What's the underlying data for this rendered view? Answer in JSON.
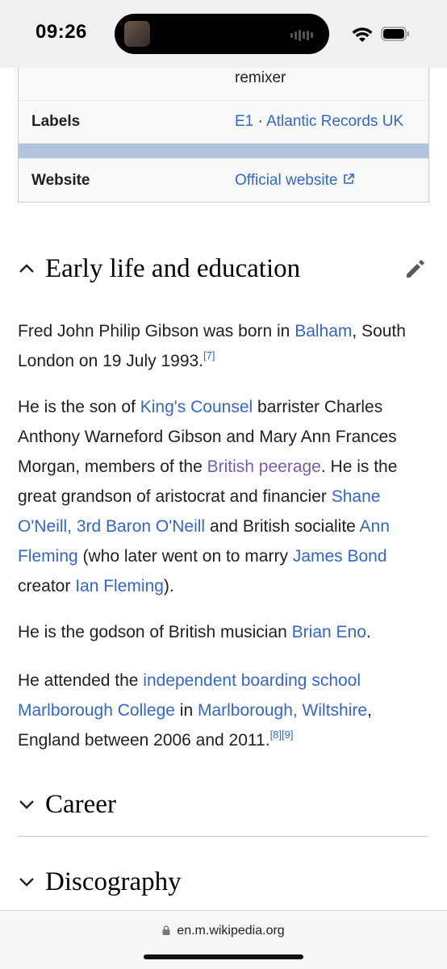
{
  "status": {
    "time": "09:26"
  },
  "infobox": {
    "partial_value": "remixer",
    "labels_label": "Labels",
    "labels_values": [
      "E1",
      "Atlantic Records UK"
    ],
    "labels_sep": " · ",
    "website_label": "Website",
    "website_value": "Official website"
  },
  "sections": {
    "early_life": "Early life and education",
    "career": "Career",
    "discography": "Discography"
  },
  "paragraphs": {
    "p1": {
      "t1": "Fred John Philip Gibson was born in ",
      "link_balham": "Balham",
      "t2": ", South London on 19 July 1993.",
      "ref7": "[7]"
    },
    "p2": {
      "t1": "He is the son of ",
      "link_kc": "King's Counsel",
      "t2": " barrister Charles Anthony Warneford Gibson and Mary Ann Frances Morgan, members of the ",
      "link_peerage": "British peerage",
      "t3": ". He is the great grandson of aristocrat and financier ",
      "link_shane": "Shane O'Neill, 3rd Baron O'Neill",
      "t4": " and British socialite ",
      "link_ann": "Ann Fleming",
      "t5": " (who later went on to marry ",
      "link_bond": "James Bond",
      "t6": " creator ",
      "link_ian": "Ian Fleming",
      "t7": ")."
    },
    "p3": {
      "t1": "He is the godson of British musician ",
      "link_eno": "Brian Eno",
      "t2": "."
    },
    "p4": {
      "t1": "He attended the ",
      "link_school": "independent boarding school",
      "t2": " ",
      "link_marlborough": "Marlborough College",
      "t3": " in ",
      "link_wilts": "Marlborough, Wiltshire",
      "t4": ", England between 2006 and 2011.",
      "ref8": "[8]",
      "ref9": "[9]"
    }
  },
  "browser": {
    "url": "en.m.wikipedia.org"
  },
  "colors": {
    "link": "#3366cc",
    "visited": "#795cb2",
    "infobox_band": "#b0c4de"
  }
}
